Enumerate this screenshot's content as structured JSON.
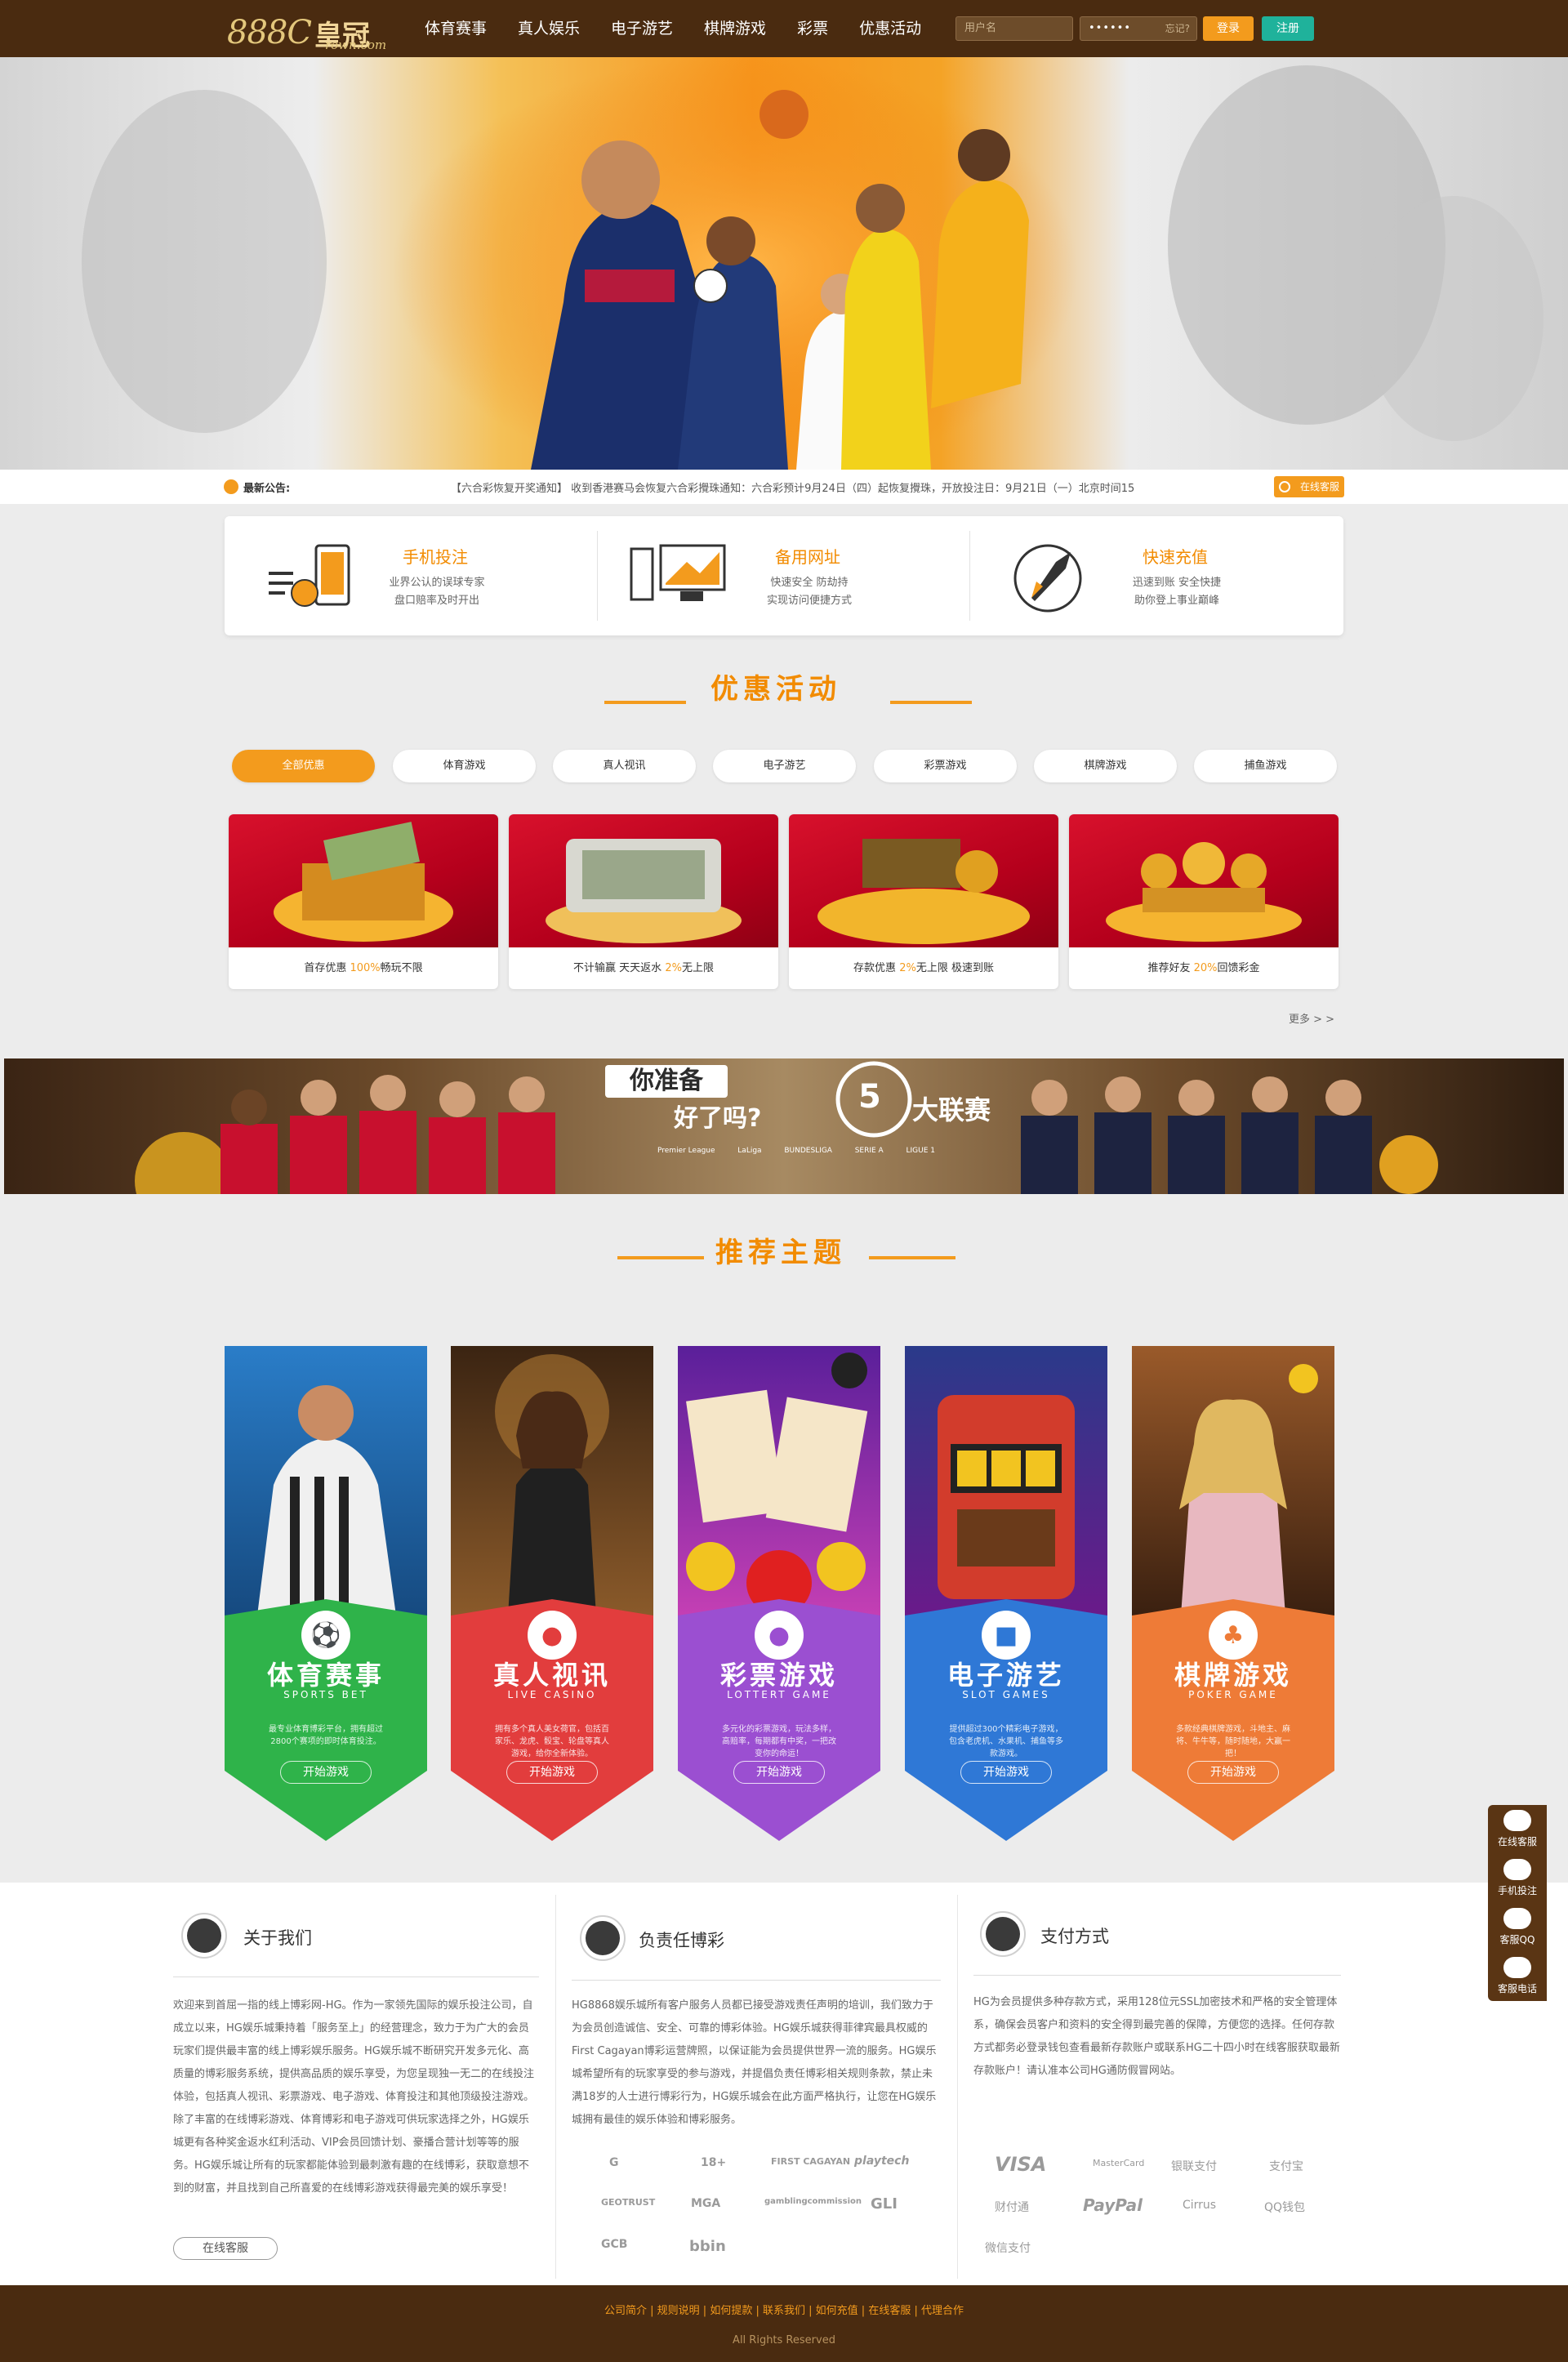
{
  "header": {
    "logo_main": "888C",
    "logo_cn": "皇冠",
    "logo_domain": "rown.com",
    "nav": [
      "体育赛事",
      "真人娱乐",
      "电子游艺",
      "棋牌游戏",
      "彩票",
      "优惠活动"
    ],
    "username_placeholder": "用户名",
    "password_mask": "••••••",
    "forgot_label": "忘记?",
    "login_label": "登录",
    "register_label": "注册",
    "colors": {
      "bar": "#4a2b10",
      "login": "#f39b1d",
      "register": "#1fb29b"
    }
  },
  "notice": {
    "label": "最新公告:",
    "text": "【六合彩恢复开奖通知】 收到香港赛马会恢复六合彩攪珠通知：六合彩预计9月24日（四）起恢复攪珠，开放投注日：9月21日（一）北京时间15",
    "service_label": "在线客服"
  },
  "features": [
    {
      "title": "手机投注",
      "lines": [
        "业界公认的误球专家",
        "盘口赔率及时开出"
      ],
      "icon": "mobile-betting-icon"
    },
    {
      "title": "备用网址",
      "lines": [
        "快速安全 防劫持",
        "实现访问便捷方式"
      ],
      "icon": "computer-icon"
    },
    {
      "title": "快速充值",
      "lines": [
        "迅速到账 安全快捷",
        "助你登上事业巅峰"
      ],
      "icon": "rocket-icon"
    }
  ],
  "promo_section": {
    "title": "优惠活动",
    "tabs": [
      "全部优惠",
      "体育游戏",
      "真人视讯",
      "电子游艺",
      "彩票游戏",
      "棋牌游戏",
      "捕鱼游戏"
    ],
    "active_tab": 0,
    "cards": [
      {
        "before": "首存优惠  ",
        "highlight": "100%",
        "after": "畅玩不限"
      },
      {
        "before": "不计输赢  天天返水  ",
        "highlight": "2%",
        "after": "无上限"
      },
      {
        "before": "存款优惠  ",
        "highlight": "2%",
        "after": "无上限  极速到账"
      },
      {
        "before": "推荐好友  ",
        "highlight": "20%",
        "after": "回馈彩金"
      }
    ],
    "more": "更多 > >"
  },
  "league_banner": {
    "line1": "你准备",
    "line2": "好了吗?",
    "number": "5",
    "suffix": "大联赛",
    "leagues": [
      "Premier League",
      "LaLiga",
      "BUNDESLIGA",
      "SERIE A",
      "LIGUE 1"
    ]
  },
  "themes_section": {
    "title": "推荐主题",
    "items": [
      {
        "title": "体育赛事",
        "sub": "SPORTS BET",
        "desc": "最专业体育博彩平台，拥有超过2800个赛项的即时体育投注。",
        "play": "开始游戏",
        "icon": "soccer-ball-icon",
        "color": "#2fb34a"
      },
      {
        "title": "真人视讯",
        "sub": "LIVE CASINO",
        "desc": "拥有多个真人美女荷官，包括百家乐、龙虎、骰宝、轮盘等真人游戏，给你全新体验。",
        "play": "开始游戏",
        "icon": "poker-chip-icon",
        "color": "#e23d3d"
      },
      {
        "title": "彩票游戏",
        "sub": "LOTTERT GAME",
        "desc": "多元化的彩票游戏，玩法多样，高赔率，每期都有中奖，一把改变你的命运！",
        "play": "开始游戏",
        "icon": "lottery-ball-icon",
        "color": "#9b4fd1"
      },
      {
        "title": "电子游艺",
        "sub": "SLOT GAMES",
        "desc": "提供超过300个精彩电子游戏，包含老虎机、水果机、捕鱼等多款游戏。",
        "play": "开始游戏",
        "icon": "slot-machine-icon",
        "color": "#2f78d6"
      },
      {
        "title": "棋牌游戏",
        "sub": "POKER GAME",
        "desc": "多款经典棋牌游戏，斗地主、麻将、牛牛等，随时随地，大赢一把！",
        "play": "开始游戏",
        "icon": "cards-icon",
        "color": "#ee7b37"
      }
    ]
  },
  "info": {
    "about": {
      "title": "关于我们",
      "text": "欢迎来到首屈一指的线上博彩网-HG。作为一家领先国际的娱乐投注公司，自成立以来，HG娱乐城秉持着「服务至上」的经营理念，致力于为广大的会员玩家们提供最丰富的线上博彩娱乐服务。HG娱乐城不断研究开发多元化、高质量的博彩服务系统，提供高品质的娱乐享受，为您呈现独一无二的在线投注体验，包括真人视讯、彩票游戏、电子游戏、体育投注和其他顶级投注游戏。除了丰富的在线博彩游戏、体育博彩和电子游戏可供玩家选择之外，HG娱乐城更有各种奖金返水红利活动、VIP会员回馈计划、豪播合营计划等等的服务。HG娱乐城让所有的玩家都能体验到最刺激有趣的在线博彩，获取意想不到的财富，并且找到自己所喜爱的在线博彩游戏获得最完美的娱乐享受！",
      "service_label": "在线客服"
    },
    "responsible": {
      "title": "负责任博彩",
      "text": "HG8868娱乐城所有客户服务人员都已接受游戏责任声明的培训，我们致力于为会员创造诚信、安全、可靠的博彩体验。HG娱乐城获得菲律宾最具权威的First Cagayan博彩运营牌照，以保证能为会员提供世界一流的服务。HG娱乐城希望所有的玩家享受的参与游戏，并提倡负责任博彩相关规则条款，禁止未满18岁的人士进行博彩行为，HG娱乐城会在此方面严格执行，让您在HG娱乐城拥有最佳的娱乐体验和博彩服务。",
      "logos": [
        "G",
        "18+",
        "FIRST CAGAYAN",
        "playtech",
        "GEOTRUST",
        "MGA",
        "gamblingcommission",
        "GLI",
        "GCB",
        "bbin"
      ]
    },
    "payment": {
      "title": "支付方式",
      "text": "HG为会员提供多种存款方式，采用128位元SSL加密技术和严格的安全管理体系，确保会员客户和资料的安全得到最完善的保障，方便您的选择。任何存款方式都务必登录钱包查看最新存款账户或联系HG二十四小时在线客服获取最新存款账户！请认准本公司HG通防假冒网站。",
      "methods": [
        "VISA",
        "MasterCard",
        "银联支付",
        "支付宝",
        "财付通",
        "PayPal",
        "Cirrus",
        "QQ钱包",
        "微信支付"
      ]
    }
  },
  "footer": {
    "links": [
      "公司简介",
      "规则说明",
      "如何提款",
      "联系我们",
      "如何充值",
      "在线客服",
      "代理合作"
    ],
    "copyright": "All Rights Reserved"
  },
  "side_float": [
    "在线客服",
    "手机投注",
    "客服QQ",
    "客服电话"
  ]
}
